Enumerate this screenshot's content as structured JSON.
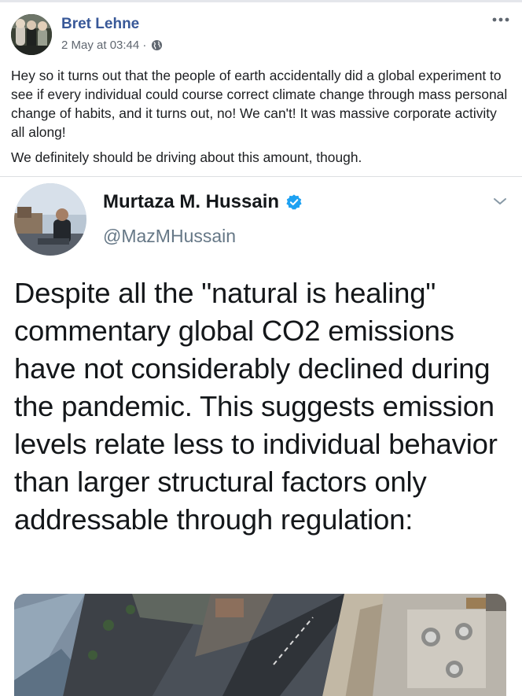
{
  "post": {
    "author": "Bret Lehne",
    "date": "2 May at 03:44 ·",
    "paragraphs": [
      "Hey so it turns out that the people of earth accidentally did a global experiment to see if every individual could course correct climate change through mass personal change of habits, and it turns out, no! We can't! It was massive corporate activity all along!",
      "We definitely should be driving about this amount, though."
    ]
  },
  "tweet": {
    "name": "Murtaza M. Hussain",
    "handle": "@MazMHussain",
    "text": "Despite all the \"natural is healing\" commentary global CO2 emissions have not considerably declined during the pandemic. This suggests emission levels relate less to individual behavior than larger structural factors only addressable through regulation:"
  },
  "icons": {
    "globe": "globe-icon",
    "more": "more-options-icon",
    "verified": "verified-badge-icon",
    "chevron": "chevron-down-icon"
  },
  "colors": {
    "author_link": "#385898",
    "meta_text": "#606770",
    "verified_blue": "#1da1f2"
  }
}
